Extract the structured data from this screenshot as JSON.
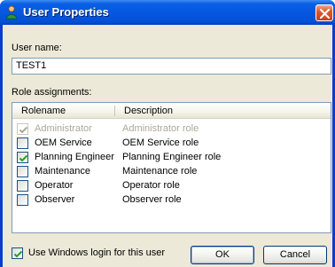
{
  "window": {
    "title": "User Properties",
    "icon": "user-icon",
    "close_icon": "close-icon"
  },
  "form": {
    "username_label": "User name:",
    "username_value": "TEST1",
    "roles_label": "Role assignments:"
  },
  "roles": {
    "columns": [
      "Rolename",
      "Description"
    ],
    "rows": [
      {
        "name": "Administrator",
        "description": "Administrator role",
        "checked": true,
        "enabled": false
      },
      {
        "name": "OEM Service",
        "description": "OEM Service role",
        "checked": false,
        "enabled": true
      },
      {
        "name": "Planning Engineer",
        "description": "Planning Engineer role",
        "checked": true,
        "enabled": true
      },
      {
        "name": "Maintenance",
        "description": "Maintenance role",
        "checked": false,
        "enabled": true
      },
      {
        "name": "Operator",
        "description": "Operator role",
        "checked": false,
        "enabled": true
      },
      {
        "name": "Observer",
        "description": "Observer role",
        "checked": false,
        "enabled": true
      }
    ]
  },
  "options": {
    "windows_login_label": "Use Windows login for this user",
    "windows_login_checked": true
  },
  "buttons": {
    "ok": "OK",
    "cancel": "Cancel"
  },
  "colors": {
    "titlebar": "#0558e0",
    "client": "#ece9d8",
    "check": "#21a121"
  }
}
